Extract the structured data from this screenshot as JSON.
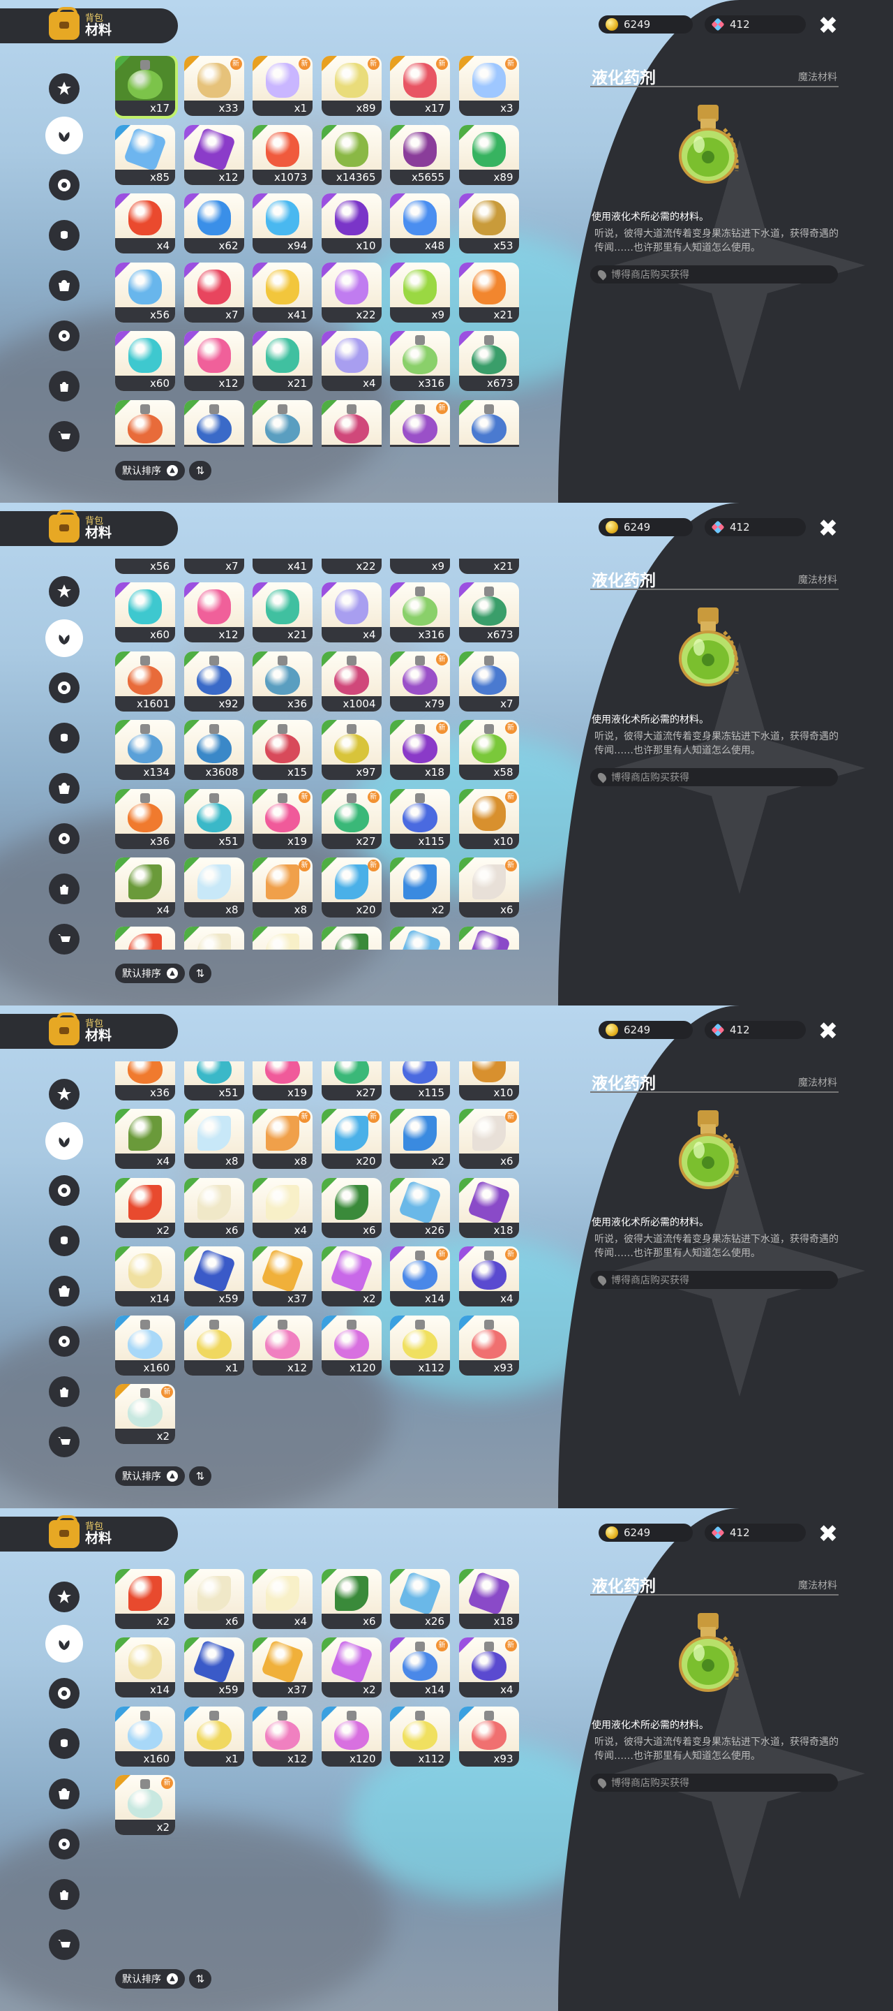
{
  "header": {
    "sub": "背包",
    "main": "材料"
  },
  "currency": {
    "coins": "6249",
    "gems": "412"
  },
  "close_label": "✖",
  "categories": [
    "star-tab",
    "leaf-tab",
    "cog-tab",
    "bug-tab",
    "basket-tab",
    "gear-tab",
    "bag-tab",
    "cart-tab"
  ],
  "sort": {
    "label": "默认排序",
    "arrow": "▲",
    "reverse": "⇅"
  },
  "detail": {
    "name": "液化药剂",
    "type": "魔法材料",
    "desc": "使用液化术所必需的材料。",
    "lore": "听说，彼得大道流传着变身果冻钻进下水道，获得奇遇的传闻……也许那里有人知道怎么使用。",
    "source": "博得商店购买获得"
  },
  "items": [
    {
      "q": "x17",
      "c": "#7cc34a",
      "r": "green",
      "a": "potion",
      "sel": true
    },
    {
      "q": "x33",
      "c": "#e6c27a",
      "r": "gold",
      "n": true
    },
    {
      "q": "x1",
      "c": "#c9b6ff",
      "r": "gold",
      "n": true
    },
    {
      "q": "x89",
      "c": "#e9dc7a",
      "r": "gold",
      "n": true
    },
    {
      "q": "x17",
      "c": "#e85563",
      "r": "gold",
      "n": true
    },
    {
      "q": "x3",
      "c": "#9ec7ff",
      "r": "gold",
      "n": true
    },
    {
      "q": "x85",
      "c": "#6db5ef",
      "r": "blue",
      "a": "crystal"
    },
    {
      "q": "x12",
      "c": "#8b3cc9",
      "r": "purple",
      "a": "crystal"
    },
    {
      "q": "x1073",
      "c": "#f05a3d",
      "r": "green"
    },
    {
      "q": "x14365",
      "c": "#8ab845",
      "r": "green"
    },
    {
      "q": "x5655",
      "c": "#8a3d9a",
      "r": "green"
    },
    {
      "q": "x89",
      "c": "#37b360",
      "r": "green"
    },
    {
      "q": "x4",
      "c": "#ea4a2e",
      "r": "purple"
    },
    {
      "q": "x62",
      "c": "#3a8fe8",
      "r": "purple"
    },
    {
      "q": "x94",
      "c": "#49b8f0",
      "r": "purple"
    },
    {
      "q": "x10",
      "c": "#7a35c8",
      "r": "purple"
    },
    {
      "q": "x48",
      "c": "#4a8ef0",
      "r": "purple"
    },
    {
      "q": "x53",
      "c": "#c99b3a",
      "r": "purple"
    },
    {
      "q": "x56",
      "c": "#68b6ec",
      "r": "purple"
    },
    {
      "q": "x7",
      "c": "#e8455e",
      "r": "purple"
    },
    {
      "q": "x41",
      "c": "#f2c63c",
      "r": "purple"
    },
    {
      "q": "x22",
      "c": "#c07cf0",
      "r": "purple"
    },
    {
      "q": "x9",
      "c": "#9ad842",
      "r": "purple"
    },
    {
      "q": "x21",
      "c": "#f2862e",
      "r": "purple"
    },
    {
      "q": "x60",
      "c": "#3ec8cf",
      "r": "purple"
    },
    {
      "q": "x12",
      "c": "#f0609a",
      "r": "purple"
    },
    {
      "q": "x21",
      "c": "#40c0a0",
      "r": "purple"
    },
    {
      "q": "x4",
      "c": "#a89ef0",
      "r": "purple"
    },
    {
      "q": "x316",
      "c": "#8ad06a",
      "r": "purple",
      "a": "potion"
    },
    {
      "q": "x673",
      "c": "#3a9e6a",
      "r": "purple",
      "a": "potion"
    },
    {
      "q": "x1601",
      "c": "#e86b3a",
      "r": "green",
      "a": "potion"
    },
    {
      "q": "x92",
      "c": "#3a6ac8",
      "r": "green",
      "a": "potion"
    },
    {
      "q": "x36",
      "c": "#5a9ec0",
      "r": "green",
      "a": "potion"
    },
    {
      "q": "x1004",
      "c": "#d0487a",
      "r": "green",
      "a": "potion"
    },
    {
      "q": "x79",
      "c": "#9a50c8",
      "r": "green",
      "a": "potion",
      "n": true
    },
    {
      "q": "x7",
      "c": "#4a7ad0",
      "r": "green",
      "a": "potion"
    },
    {
      "q": "x134",
      "c": "#5aa0d8",
      "r": "green",
      "a": "potion"
    },
    {
      "q": "x3608",
      "c": "#3a88c8",
      "r": "green",
      "a": "potion"
    },
    {
      "q": "x15",
      "c": "#d84a5a",
      "r": "green",
      "a": "potion"
    },
    {
      "q": "x97",
      "c": "#d8c43a",
      "r": "green",
      "a": "potion"
    },
    {
      "q": "x18",
      "c": "#8a3ac8",
      "r": "green",
      "a": "potion",
      "n": true
    },
    {
      "q": "x58",
      "c": "#7ac83a",
      "r": "green",
      "a": "potion",
      "n": true
    },
    {
      "q": "x36",
      "c": "#f07a2e",
      "r": "green",
      "a": "potion"
    },
    {
      "q": "x51",
      "c": "#3ab8c8",
      "r": "green",
      "a": "potion"
    },
    {
      "q": "x19",
      "c": "#f05a9a",
      "r": "green",
      "a": "potion",
      "n": true
    },
    {
      "q": "x27",
      "c": "#3ab878",
      "r": "green",
      "a": "potion",
      "n": true
    },
    {
      "q": "x115",
      "c": "#4a6ae0",
      "r": "green",
      "a": "potion"
    },
    {
      "q": "x10",
      "c": "#d8902e",
      "r": "green",
      "n": true
    },
    {
      "q": "x4",
      "c": "#6a9a3a",
      "r": "green",
      "a": "flower"
    },
    {
      "q": "x8",
      "c": "#c8e8f8",
      "r": "green",
      "a": "flower"
    },
    {
      "q": "x8",
      "c": "#f0a04a",
      "r": "green",
      "a": "flower",
      "n": true
    },
    {
      "q": "x20",
      "c": "#4ab0e8",
      "r": "green",
      "a": "flower",
      "n": true
    },
    {
      "q": "x2",
      "c": "#3a8ae0",
      "r": "green",
      "a": "flower"
    },
    {
      "q": "x6",
      "c": "#e8e0d8",
      "r": "green",
      "a": "flower",
      "n": true
    },
    {
      "q": "x2",
      "c": "#e84a2e",
      "r": "green",
      "a": "flower"
    },
    {
      "q": "x6",
      "c": "#f0e8c8",
      "r": "green",
      "a": "flower"
    },
    {
      "q": "x4",
      "c": "#f8f0c8",
      "r": "green",
      "a": "flower"
    },
    {
      "q": "x6",
      "c": "#3a8a3a",
      "r": "green",
      "a": "flower"
    },
    {
      "q": "x26",
      "c": "#6ab8e8",
      "r": "green",
      "a": "crystal"
    },
    {
      "q": "x18",
      "c": "#8a4ac8",
      "r": "green",
      "a": "crystal"
    },
    {
      "q": "x14",
      "c": "#f0e0a0",
      "r": "green"
    },
    {
      "q": "x59",
      "c": "#3a5ac8",
      "r": "green",
      "a": "crystal"
    },
    {
      "q": "x37",
      "c": "#f0b03a",
      "r": "green",
      "a": "crystal"
    },
    {
      "q": "x2",
      "c": "#c868e8",
      "r": "green",
      "a": "crystal"
    },
    {
      "q": "x14",
      "c": "#4a88e8",
      "r": "purple",
      "a": "potion",
      "n": true
    },
    {
      "q": "x4",
      "c": "#5a4ad0",
      "r": "purple",
      "a": "potion",
      "n": true
    },
    {
      "q": "x160",
      "c": "#a8d8f8",
      "r": "blue",
      "a": "potion"
    },
    {
      "q": "x1",
      "c": "#f0d860",
      "r": "blue",
      "a": "potion"
    },
    {
      "q": "x12",
      "c": "#f080c0",
      "r": "blue",
      "a": "potion"
    },
    {
      "q": "x120",
      "c": "#d870e0",
      "r": "blue",
      "a": "potion"
    },
    {
      "q": "x112",
      "c": "#f0e060",
      "r": "blue",
      "a": "potion"
    },
    {
      "q": "x93",
      "c": "#f07070",
      "r": "blue",
      "a": "potion"
    },
    {
      "q": "x2",
      "c": "#c8e8e0",
      "r": "gold",
      "a": "potion",
      "n": true
    }
  ]
}
